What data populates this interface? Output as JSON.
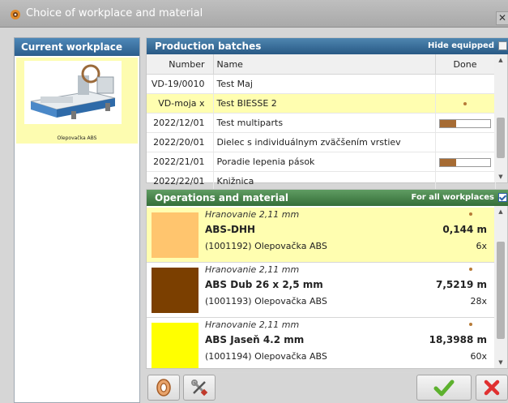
{
  "window": {
    "title": "Choice of workplace and material",
    "close_glyph": "✕"
  },
  "left": {
    "header": "Current workplace",
    "workplace": {
      "name": "Olepovačka ABS",
      "icon": "edgebander-machine-image"
    }
  },
  "batches": {
    "header": "Production batches",
    "hide_equipped_label": "Hide equipped",
    "hide_equipped_checked": false,
    "columns": [
      "Number",
      "Name",
      "Done"
    ],
    "rows": [
      {
        "number": "VD-19/0010",
        "name": "Test Maj",
        "done": "none",
        "progress": 0
      },
      {
        "number": "VD-moja x",
        "name": "Test BIESSE 2",
        "done": "dot",
        "progress": 0
      },
      {
        "number": "2022/12/01",
        "name": "Test multiparts",
        "done": "bar",
        "progress": 0.32
      },
      {
        "number": "2022/20/01",
        "name": "Dielec s individuálnym zväčšením vrstiev",
        "done": "none",
        "progress": 0
      },
      {
        "number": "2022/21/01",
        "name": "Poradie lepenia pások",
        "done": "bar",
        "progress": 0.32
      },
      {
        "number": "2022/22/01",
        "name": "Knižnica",
        "done": "none",
        "progress": 0
      }
    ]
  },
  "operations": {
    "header": "Operations and material",
    "for_all_label": "For all workplaces",
    "for_all_checked": true,
    "items": [
      {
        "subtitle": "Hranovanie 2,11 mm",
        "name": "ABS-DHH",
        "code": "(1001192)  Olepovačka ABS",
        "length": "0,144 m",
        "qty": "6x",
        "color": "#ffc56e"
      },
      {
        "subtitle": "Hranovanie 2,11 mm",
        "name": "ABS Dub 26 x 2,5 mm",
        "code": "(1001193)  Olepovačka ABS",
        "length": "7,5219 m",
        "qty": "28x",
        "color": "#7b3f00"
      },
      {
        "subtitle": "Hranovanie 2,11 mm",
        "name": "ABS Jaseň 4.2 mm",
        "code": "(1001194)  Olepovačka ABS",
        "length": "18,3988 m",
        "qty": "60x",
        "color": "#ffff00"
      }
    ]
  },
  "buttons": {
    "left": [
      "material-roll-icon",
      "tools-icon"
    ],
    "confirm": "check-icon",
    "cancel": "cancel-x-icon"
  }
}
